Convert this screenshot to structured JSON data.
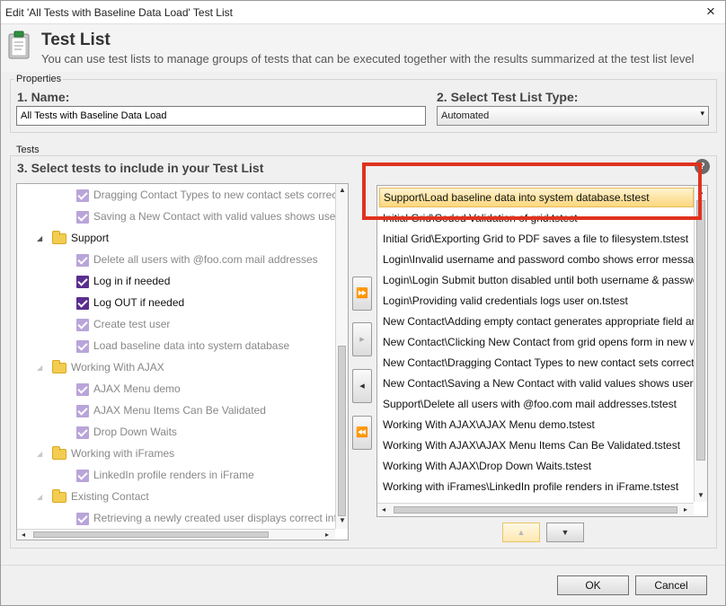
{
  "window": {
    "title": "Edit 'All Tests with Baseline Data Load' Test List",
    "close_glyph": "×"
  },
  "header": {
    "title": "Test List",
    "subtitle": "You can use test lists to manage groups of tests that can be executed together with the results summarized at the test list level",
    "icon": "clipboard-icon"
  },
  "properties": {
    "group_label": "Properties",
    "name_label": "1. Name:",
    "name_value": "All Tests with Baseline Data Load",
    "type_label": "2. Select Test List Type:",
    "type_value": "Automated"
  },
  "tests": {
    "group_label": "Tests",
    "section_label": "3. Select tests to include in your Test List",
    "help_glyph": "?",
    "tree": [
      {
        "kind": "test",
        "label": "Dragging Contact Types to new contact sets correct val",
        "checked": false
      },
      {
        "kind": "test",
        "label": "Saving a New Contact with valid values shows user on g",
        "checked": false
      },
      {
        "kind": "folder",
        "label": "Support",
        "expanded": true,
        "active": true
      },
      {
        "kind": "test",
        "label": "Delete all users with @foo.com mail addresses",
        "checked": false
      },
      {
        "kind": "test",
        "label": "Log in if needed",
        "checked": true
      },
      {
        "kind": "test",
        "label": "Log OUT if needed",
        "checked": true
      },
      {
        "kind": "test",
        "label": "Create test user",
        "checked": false
      },
      {
        "kind": "test",
        "label": "Load baseline data into system database",
        "checked": false
      },
      {
        "kind": "folder",
        "label": "Working With AJAX",
        "expanded": true,
        "active": false
      },
      {
        "kind": "test",
        "label": "AJAX Menu demo",
        "checked": false
      },
      {
        "kind": "test",
        "label": "AJAX Menu Items Can Be Validated",
        "checked": false
      },
      {
        "kind": "test",
        "label": "Drop Down Waits",
        "checked": false
      },
      {
        "kind": "folder",
        "label": "Working with iFrames",
        "expanded": true,
        "active": false
      },
      {
        "kind": "test",
        "label": "LinkedIn profile renders in iFrame",
        "checked": false
      },
      {
        "kind": "folder",
        "label": "Existing Contact",
        "expanded": true,
        "active": false
      },
      {
        "kind": "test",
        "label": "Retrieving a newly created user displays correct informa",
        "checked": false
      }
    ],
    "move_buttons": {
      "add_all": "⏩",
      "add": "▸",
      "remove": "◂",
      "remove_all": "⏪"
    },
    "selected_list": [
      "Support\\Load baseline data into system database.tstest",
      "Initial Grid\\Coded Validation of grid.tstest",
      "Initial Grid\\Exporting Grid to PDF saves a file to filesystem.tstest",
      "Login\\Invalid username and password combo shows error message.tstest",
      "Login\\Login Submit button disabled until both username & password entered.tstest",
      "Login\\Providing valid credentials logs user on.tstest",
      "New Contact\\Adding empty contact generates appropriate field and style",
      "New Contact\\Clicking New Contact from grid opens form in new window",
      "New Contact\\Dragging Contact Types to new contact sets correct values",
      "New Contact\\Saving a New Contact with valid values shows user on grid",
      "Support\\Delete all users with @foo.com mail addresses.tstest",
      "Working With AJAX\\AJAX Menu demo.tstest",
      "Working With AJAX\\AJAX Menu Items Can Be Validated.tstest",
      "Working With AJAX\\Drop Down Waits.tstest",
      "Working with iFrames\\LinkedIn profile renders in iFrame.tstest"
    ],
    "selected_index": 0,
    "order_up": "▲",
    "order_down": "▼"
  },
  "footer": {
    "ok_label": "OK",
    "cancel_label": "Cancel"
  },
  "colors": {
    "annotation_red": "#e0321e",
    "selected_row": "#fbd77d",
    "checkbox_checked": "#5a2e8e",
    "checkbox_unchecked": "#b9a5d9",
    "folder": "#f2cd52"
  }
}
